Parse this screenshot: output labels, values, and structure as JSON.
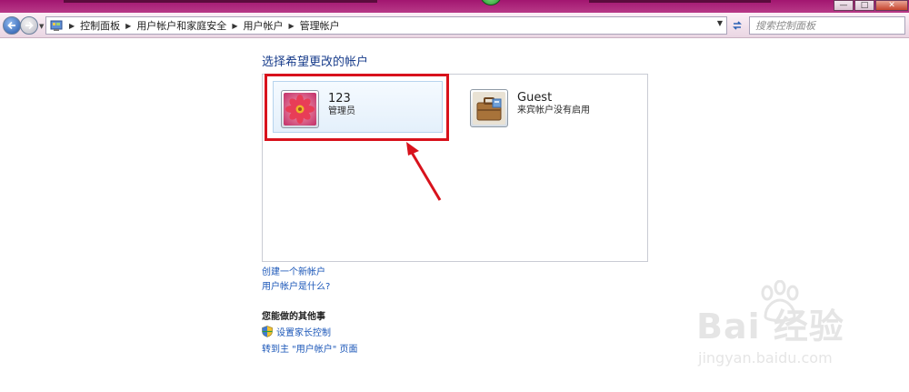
{
  "window": {
    "minimize_label": "—",
    "maximize_label": "□",
    "close_label": "✕"
  },
  "address_bar": {
    "breadcrumbs": [
      "控制面板",
      "用户帐户和家庭安全",
      "用户帐户",
      "管理帐户"
    ],
    "search_placeholder": "搜索控制面板"
  },
  "main": {
    "heading": "选择希望更改的帐户",
    "accounts": [
      {
        "name": "123",
        "role": "管理员",
        "avatar": "flower-avatar-icon"
      },
      {
        "name": "Guest",
        "role": "来宾帐户没有启用",
        "avatar": "briefcase-avatar-icon"
      }
    ],
    "links": [
      "创建一个新帐户",
      "用户帐户是什么?"
    ],
    "other_title": "您能做的其他事",
    "tasks": [
      {
        "label": "设置家长控制",
        "icon": "shield-icon"
      },
      {
        "label": "转到主 \"用户帐户\" 页面",
        "icon": ""
      }
    ]
  },
  "watermark": {
    "text": "Bai 经验",
    "sub": "jingyan.baidu.com"
  },
  "colors": {
    "heading": "#1a3e8c",
    "link": "#1a56b8",
    "highlight": "#d8121c",
    "title_strip": "#a21670"
  }
}
